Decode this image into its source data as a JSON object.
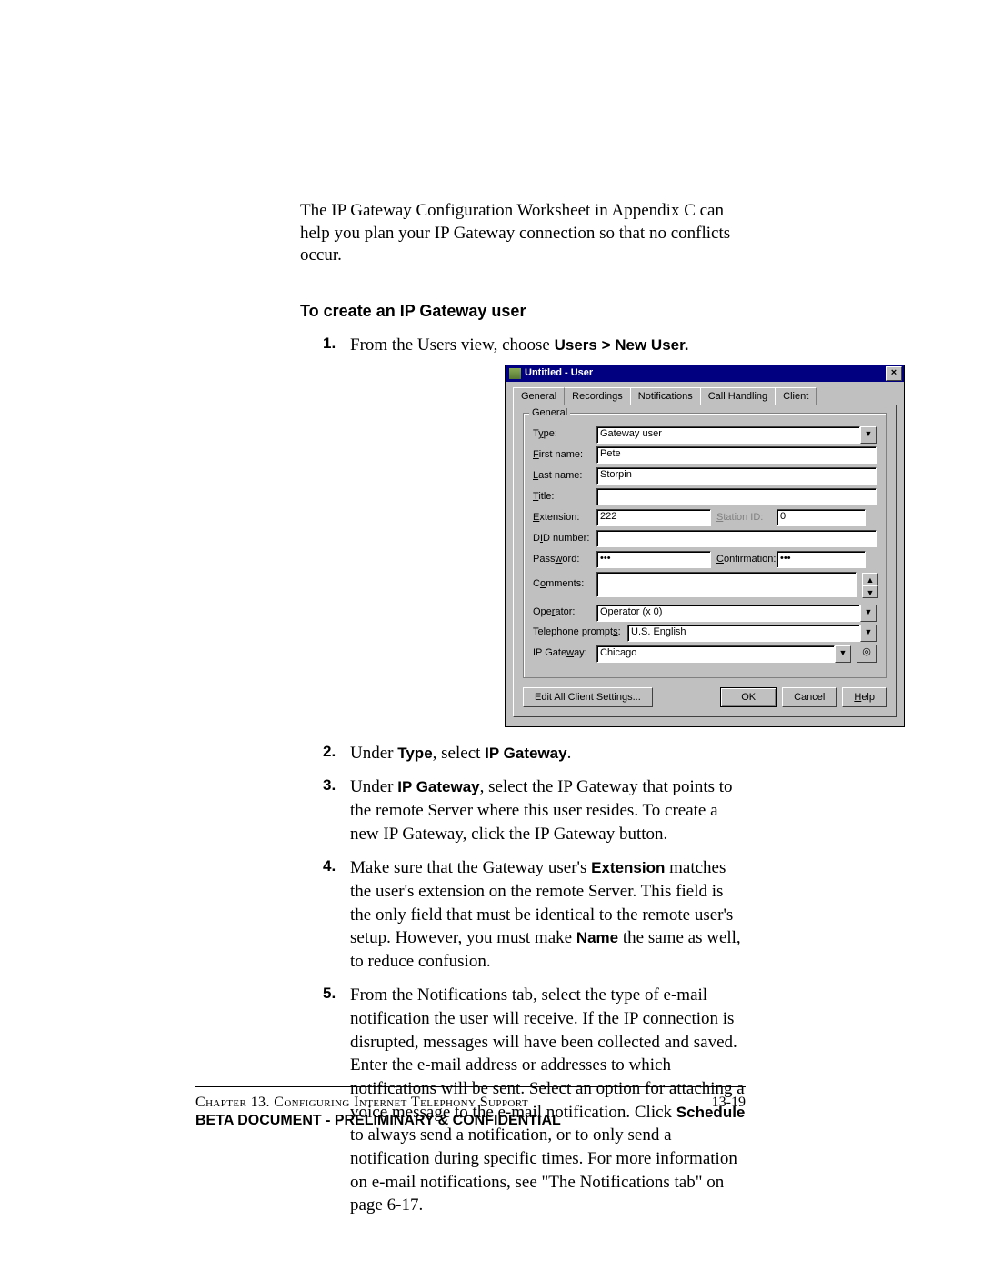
{
  "intro": "The IP Gateway Configuration Worksheet in Appendix C can help you plan your IP Gateway connection so that no conflicts occur.",
  "heading": "To create an IP Gateway user",
  "steps": {
    "s1_pre": "From the Users view, choose ",
    "s1_bold": "Users > New User.",
    "s2_a": "Under ",
    "s2_b": "Type",
    "s2_c": ", select ",
    "s2_d": "IP Gateway",
    "s2_e": ".",
    "s3_a": "Under ",
    "s3_b": "IP Gateway",
    "s3_c": ", select the IP Gateway that points to the remote Server where this user resides. To create a new IP Gateway, click the IP Gateway button.",
    "s4_a": "Make sure that the Gateway user's ",
    "s4_b": "Extension",
    "s4_c": " matches the user's extension on the remote Server. This field is the only field that must be identical to the remote user's setup. However, you must make ",
    "s4_d": "Name",
    "s4_e": " the same as well, to reduce confusion.",
    "s5_a": "From the Notifications tab, select the type of e-mail notification the user will receive. If the IP connection is disrupted, messages will have been collected and saved. Enter the e-mail address or addresses to which notifications will be sent. Select an option for attaching a voice message to the e-mail notification. Click ",
    "s5_b": "Schedule",
    "s5_c": " to always send a notification, or to only send a notification during specific times. For more information on e-mail notifications, see \"The Notifications tab\" on page 6-17."
  },
  "dialog": {
    "title": "Untitled - User",
    "tabs": [
      "General",
      "Recordings",
      "Notifications",
      "Call Handling",
      "Client"
    ],
    "group": "General",
    "labels": {
      "type": "Type:",
      "first": "First name:",
      "last": "Last name:",
      "titlef": "Title:",
      "ext": "Extension:",
      "station": "Station ID:",
      "did": "DID number:",
      "pwd": "Password:",
      "conf": "Confirmation:",
      "comments": "Comments:",
      "operator": "Operator:",
      "prompts": "Telephone prompts:",
      "ipgw": "IP Gateway:"
    },
    "values": {
      "type": "Gateway user",
      "first": "Pete",
      "last": "Storpin",
      "titlef": "",
      "ext": "222",
      "station": "0",
      "did": "",
      "pwd": "•••",
      "conf": "•••",
      "comments": "",
      "operator": "Operator (x 0)",
      "prompts": "U.S. English",
      "ipgw": "Chicago"
    },
    "buttons": {
      "edit": "Edit All Client Settings...",
      "ok": "OK",
      "cancel": "Cancel",
      "help": "Help"
    }
  },
  "footer": {
    "chapter": "Chapter 13. Configuring Internet Telephony Support",
    "pagenum": "13-19",
    "conf": "BETA DOCUMENT - PRELIMINARY & CONFIDENTIAL"
  }
}
